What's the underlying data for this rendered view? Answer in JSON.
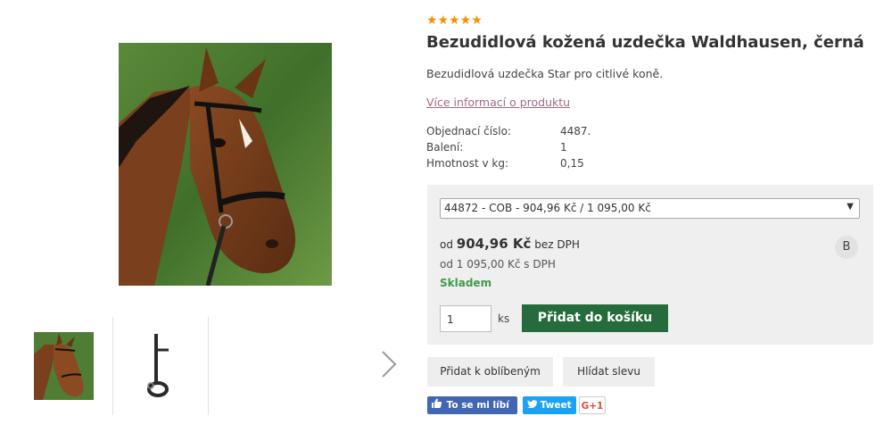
{
  "product": {
    "rating_stars": "★★★★★",
    "title": "Bezudidlová kožená uzdečka Waldhausen, černá",
    "description": "Bezudidlová uzdečka Star pro citlivé koně.",
    "more_info_link": "Více informací o produktu",
    "specs": [
      {
        "label": "Objednací číslo:",
        "value": "4487."
      },
      {
        "label": "Balení:",
        "value": "1"
      },
      {
        "label": "Hmotnost v kg:",
        "value": "0,15"
      }
    ]
  },
  "buybox": {
    "variant_selected": "44872 - COB - 904,96 Kč / 1 095,00 Kč",
    "price_prefix": "od",
    "price_main": "904,96 Kč",
    "price_suffix": "bez DPH",
    "price_vat": "od 1 095,00 Kč s DPH",
    "stock_status": "Skladem",
    "badge": "B",
    "quantity": "1",
    "quantity_unit": "ks",
    "add_to_cart": "Přidat do košíku"
  },
  "actions": {
    "add_favorite": "Přidat k oblíbeným",
    "watch_discount": "Hlídat slevu"
  },
  "social": {
    "facebook": "To se mi líbí 0",
    "twitter": "Tweet",
    "gplus": "G+1"
  },
  "colors": {
    "accent_orange": "#f39200",
    "cart_green": "#266b3b",
    "stock_green": "#3e9b4a",
    "link_mauve": "#a06a85"
  },
  "icons": [
    "chevron-right-icon",
    "facebook-thumb-icon",
    "twitter-bird-icon",
    "dropdown-arrow-icon"
  ]
}
